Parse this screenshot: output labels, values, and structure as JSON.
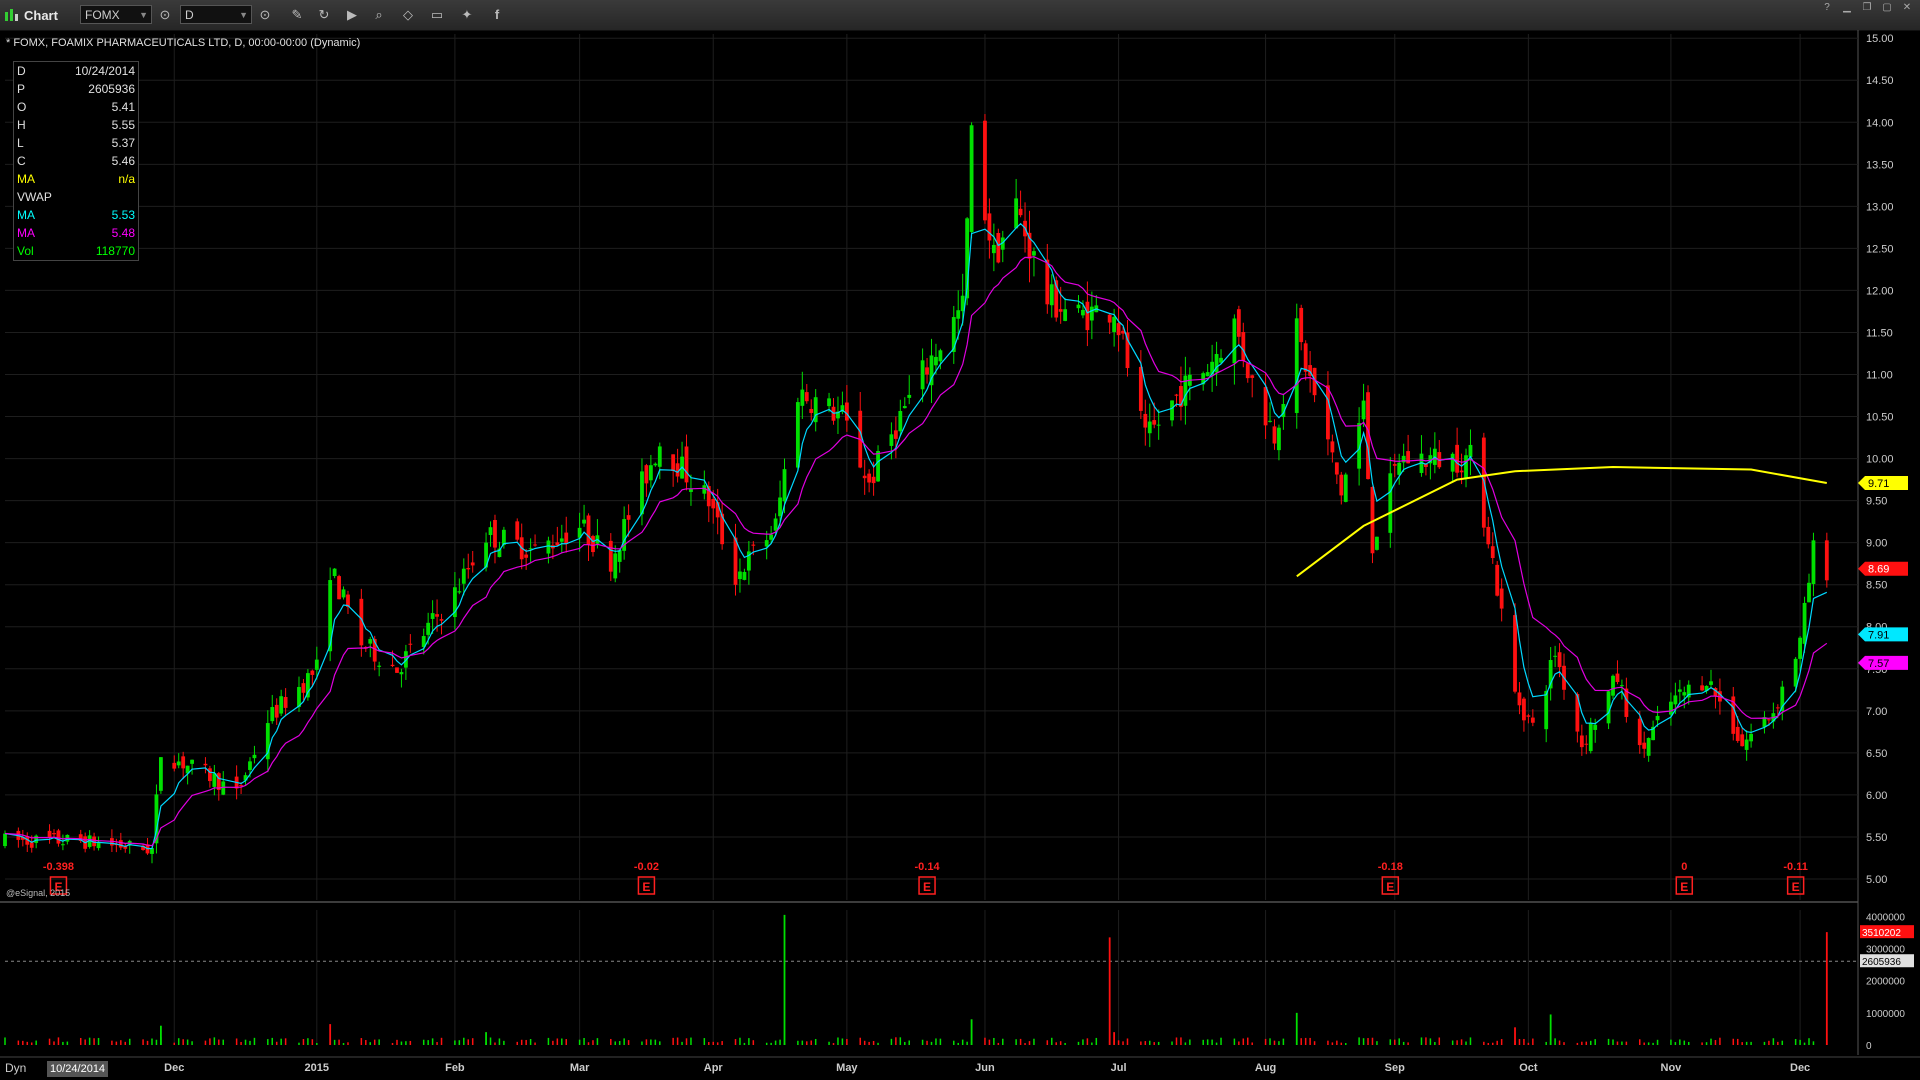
{
  "window": {
    "title": "Chart",
    "symbol_value": "FOMX",
    "interval_value": "D",
    "toolbar_icons": [
      "symbol-link-icon",
      "interval-link-icon",
      "pencil-icon",
      "refresh-icon",
      "play-icon",
      "zoom-icon",
      "tag-icon",
      "chat-icon",
      "twitter-icon",
      "facebook-icon"
    ],
    "window_buttons": [
      "help-icon",
      "minimize-icon",
      "restore-icon",
      "maximize-icon",
      "close-icon"
    ]
  },
  "header": {
    "title": "* FOMX, FOAMIX PHARMACEUTICALS LTD, D, 00:00-00:00 (Dynamic)"
  },
  "data_window": {
    "rows": [
      {
        "key": "D",
        "value": "10/24/2014",
        "color": "#e0e0e0"
      },
      {
        "key": "P",
        "value": "2605936",
        "color": "#e0e0e0"
      },
      {
        "key": "O",
        "value": "5.41",
        "color": "#e0e0e0"
      },
      {
        "key": "H",
        "value": "5.55",
        "color": "#e0e0e0"
      },
      {
        "key": "L",
        "value": "5.37",
        "color": "#e0e0e0"
      },
      {
        "key": "C",
        "value": "5.46",
        "color": "#e0e0e0"
      },
      {
        "key": "MA",
        "value": "n/a",
        "color": "#ffff00"
      },
      {
        "key": "VWAP",
        "value": "",
        "color": "#e0e0e0"
      },
      {
        "key": "MA",
        "value": "5.53",
        "color": "#00ffff"
      },
      {
        "key": "MA",
        "value": "5.48",
        "color": "#ff00ff"
      },
      {
        "key": "Vol",
        "value": "118770",
        "color": "#00ff00"
      }
    ]
  },
  "credit": "@eSignal, 2015",
  "bottom": {
    "mode": "Dyn",
    "date": "10/24/2014"
  },
  "colors": {
    "up": "#00e000",
    "down": "#ff1010",
    "ma_fast": "#00d8ff",
    "ma_slow": "#e000e0",
    "ma_long": "#ffff00",
    "earnings": "#ff2020",
    "grid": "#1e1e1e"
  },
  "chart_data": {
    "type": "candlestick",
    "y_range": [
      4.75,
      15.05
    ],
    "y_ticks": [
      "15.00",
      "14.50",
      "14.00",
      "13.50",
      "13.00",
      "12.50",
      "12.00",
      "11.50",
      "11.00",
      "10.50",
      "10.00",
      "9.50",
      "9.00",
      "8.50",
      "8.00",
      "7.50",
      "7.00",
      "6.50",
      "6.00",
      "5.50",
      "5.00"
    ],
    "x_range": [
      "2014-10-24",
      "2015-12-14"
    ],
    "x_labels": [
      {
        "label": "Dec",
        "date": "2014-12-01"
      },
      {
        "label": "2015",
        "date": "2015-01-02"
      },
      {
        "label": "Feb",
        "date": "2015-02-02"
      },
      {
        "label": "Mar",
        "date": "2015-03-02"
      },
      {
        "label": "Apr",
        "date": "2015-04-01"
      },
      {
        "label": "May",
        "date": "2015-05-01"
      },
      {
        "label": "Jun",
        "date": "2015-06-01"
      },
      {
        "label": "Jul",
        "date": "2015-07-01"
      },
      {
        "label": "Aug",
        "date": "2015-08-03"
      },
      {
        "label": "Sep",
        "date": "2015-09-01"
      },
      {
        "label": "Oct",
        "date": "2015-10-01"
      },
      {
        "label": "Nov",
        "date": "2015-11-02"
      },
      {
        "label": "Dec",
        "date": "2015-12-01"
      }
    ],
    "price_path": [
      {
        "date": "2014-10-24",
        "close": 5.46
      },
      {
        "date": "2014-11-10",
        "close": 5.45
      },
      {
        "date": "2014-11-26",
        "close": 5.35
      },
      {
        "date": "2014-11-28",
        "close": 6.5
      },
      {
        "date": "2014-12-10",
        "close": 6.2
      },
      {
        "date": "2014-12-15",
        "close": 6.0
      },
      {
        "date": "2014-12-22",
        "close": 6.9
      },
      {
        "date": "2015-01-02",
        "close": 7.5
      },
      {
        "date": "2015-01-05",
        "close": 8.7
      },
      {
        "date": "2015-01-12",
        "close": 7.8
      },
      {
        "date": "2015-01-20",
        "close": 7.5
      },
      {
        "date": "2015-02-02",
        "close": 8.4
      },
      {
        "date": "2015-02-09",
        "close": 9.1
      },
      {
        "date": "2015-02-20",
        "close": 8.9
      },
      {
        "date": "2015-03-02",
        "close": 9.2
      },
      {
        "date": "2015-03-09",
        "close": 8.8
      },
      {
        "date": "2015-03-20",
        "close": 10.2
      },
      {
        "date": "2015-03-31",
        "close": 9.5
      },
      {
        "date": "2015-04-06",
        "close": 8.6
      },
      {
        "date": "2015-04-15",
        "close": 9.2
      },
      {
        "date": "2015-04-20",
        "close": 10.8
      },
      {
        "date": "2015-04-30",
        "close": 10.5
      },
      {
        "date": "2015-05-06",
        "close": 9.7
      },
      {
        "date": "2015-05-12",
        "close": 10.4
      },
      {
        "date": "2015-05-20",
        "close": 11.2
      },
      {
        "date": "2015-05-27",
        "close": 11.8
      },
      {
        "date": "2015-05-29",
        "close": 13.8
      },
      {
        "date": "2015-06-03",
        "close": 12.4
      },
      {
        "date": "2015-06-08",
        "close": 13.0
      },
      {
        "date": "2015-06-15",
        "close": 11.9
      },
      {
        "date": "2015-06-22",
        "close": 11.7
      },
      {
        "date": "2015-06-30",
        "close": 11.8
      },
      {
        "date": "2015-07-07",
        "close": 10.2
      },
      {
        "date": "2015-07-15",
        "close": 10.8
      },
      {
        "date": "2015-07-21",
        "close": 11.1
      },
      {
        "date": "2015-07-27",
        "close": 11.6
      },
      {
        "date": "2015-07-31",
        "close": 10.9
      },
      {
        "date": "2015-08-05",
        "close": 10.3
      },
      {
        "date": "2015-08-10",
        "close": 11.5
      },
      {
        "date": "2015-08-20",
        "close": 9.6
      },
      {
        "date": "2015-08-25",
        "close": 10.6
      },
      {
        "date": "2015-08-27",
        "close": 9.0
      },
      {
        "date": "2015-09-02",
        "close": 10.0
      },
      {
        "date": "2015-09-18",
        "close": 10.0
      },
      {
        "date": "2015-09-22",
        "close": 9.1
      },
      {
        "date": "2015-09-28",
        "close": 7.2
      },
      {
        "date": "2015-10-02",
        "close": 6.8
      },
      {
        "date": "2015-10-07",
        "close": 7.7
      },
      {
        "date": "2015-10-13",
        "close": 6.6
      },
      {
        "date": "2015-10-21",
        "close": 7.4
      },
      {
        "date": "2015-10-26",
        "close": 6.5
      },
      {
        "date": "2015-11-02",
        "close": 7.1
      },
      {
        "date": "2015-11-10",
        "close": 7.4
      },
      {
        "date": "2015-11-18",
        "close": 6.6
      },
      {
        "date": "2015-11-25",
        "close": 7.0
      },
      {
        "date": "2015-12-01",
        "close": 7.8
      },
      {
        "date": "2015-12-04",
        "close": 8.9
      },
      {
        "date": "2015-12-07",
        "close": 8.69
      }
    ],
    "sma200": [
      {
        "date": "2015-08-10",
        "value": 8.6
      },
      {
        "date": "2015-08-25",
        "value": 9.2
      },
      {
        "date": "2015-09-15",
        "value": 9.75
      },
      {
        "date": "2015-09-28",
        "value": 9.85
      },
      {
        "date": "2015-10-20",
        "value": 9.9
      },
      {
        "date": "2015-11-20",
        "value": 9.87
      },
      {
        "date": "2015-12-07",
        "value": 9.71
      }
    ],
    "price_labels": [
      {
        "value": 9.71,
        "text": "9.71",
        "bg": "#ffff00",
        "fg": "#000"
      },
      {
        "value": 8.69,
        "text": "8.69",
        "bg": "#ff1010",
        "fg": "#fff"
      },
      {
        "value": 7.91,
        "text": "7.91",
        "bg": "#00e8ff",
        "fg": "#000"
      },
      {
        "value": 7.57,
        "text": "7.57",
        "bg": "#ff00ff",
        "fg": "#000"
      }
    ],
    "earnings": [
      {
        "date": "2014-11-05",
        "text": "-0.398"
      },
      {
        "date": "2015-03-17",
        "text": "-0.02"
      },
      {
        "date": "2015-05-19",
        "text": "-0.14"
      },
      {
        "date": "2015-08-31",
        "text": "-0.18"
      },
      {
        "date": "2015-11-05",
        "text": "0"
      },
      {
        "date": "2015-11-30",
        "text": "-0.11"
      }
    ],
    "volume": {
      "y_range": [
        0,
        4200000
      ],
      "y_ticks": [
        "4000000",
        "3000000",
        "2000000",
        "1000000",
        "0"
      ],
      "labels": [
        {
          "value": 3510202,
          "text": "3510202",
          "bg": "#ff1010",
          "fg": "#fff"
        },
        {
          "value": 2605936,
          "text": "2605936",
          "bg": "#e0e0e0",
          "fg": "#000"
        }
      ],
      "spikes": [
        {
          "date": "2014-11-28",
          "value": 600000,
          "up": true
        },
        {
          "date": "2015-01-05",
          "value": 650000,
          "up": false
        },
        {
          "date": "2015-02-09",
          "value": 400000,
          "up": true
        },
        {
          "date": "2015-04-17",
          "value": 4050000,
          "up": true
        },
        {
          "date": "2015-05-29",
          "value": 800000,
          "up": true
        },
        {
          "date": "2015-06-29",
          "value": 3350000,
          "up": false
        },
        {
          "date": "2015-06-30",
          "value": 400000,
          "up": false
        },
        {
          "date": "2015-08-10",
          "value": 1000000,
          "up": true
        },
        {
          "date": "2015-09-28",
          "value": 550000,
          "up": false
        },
        {
          "date": "2015-10-06",
          "value": 950000,
          "up": true
        },
        {
          "date": "2015-12-07",
          "value": 3510202,
          "up": false
        }
      ]
    }
  }
}
